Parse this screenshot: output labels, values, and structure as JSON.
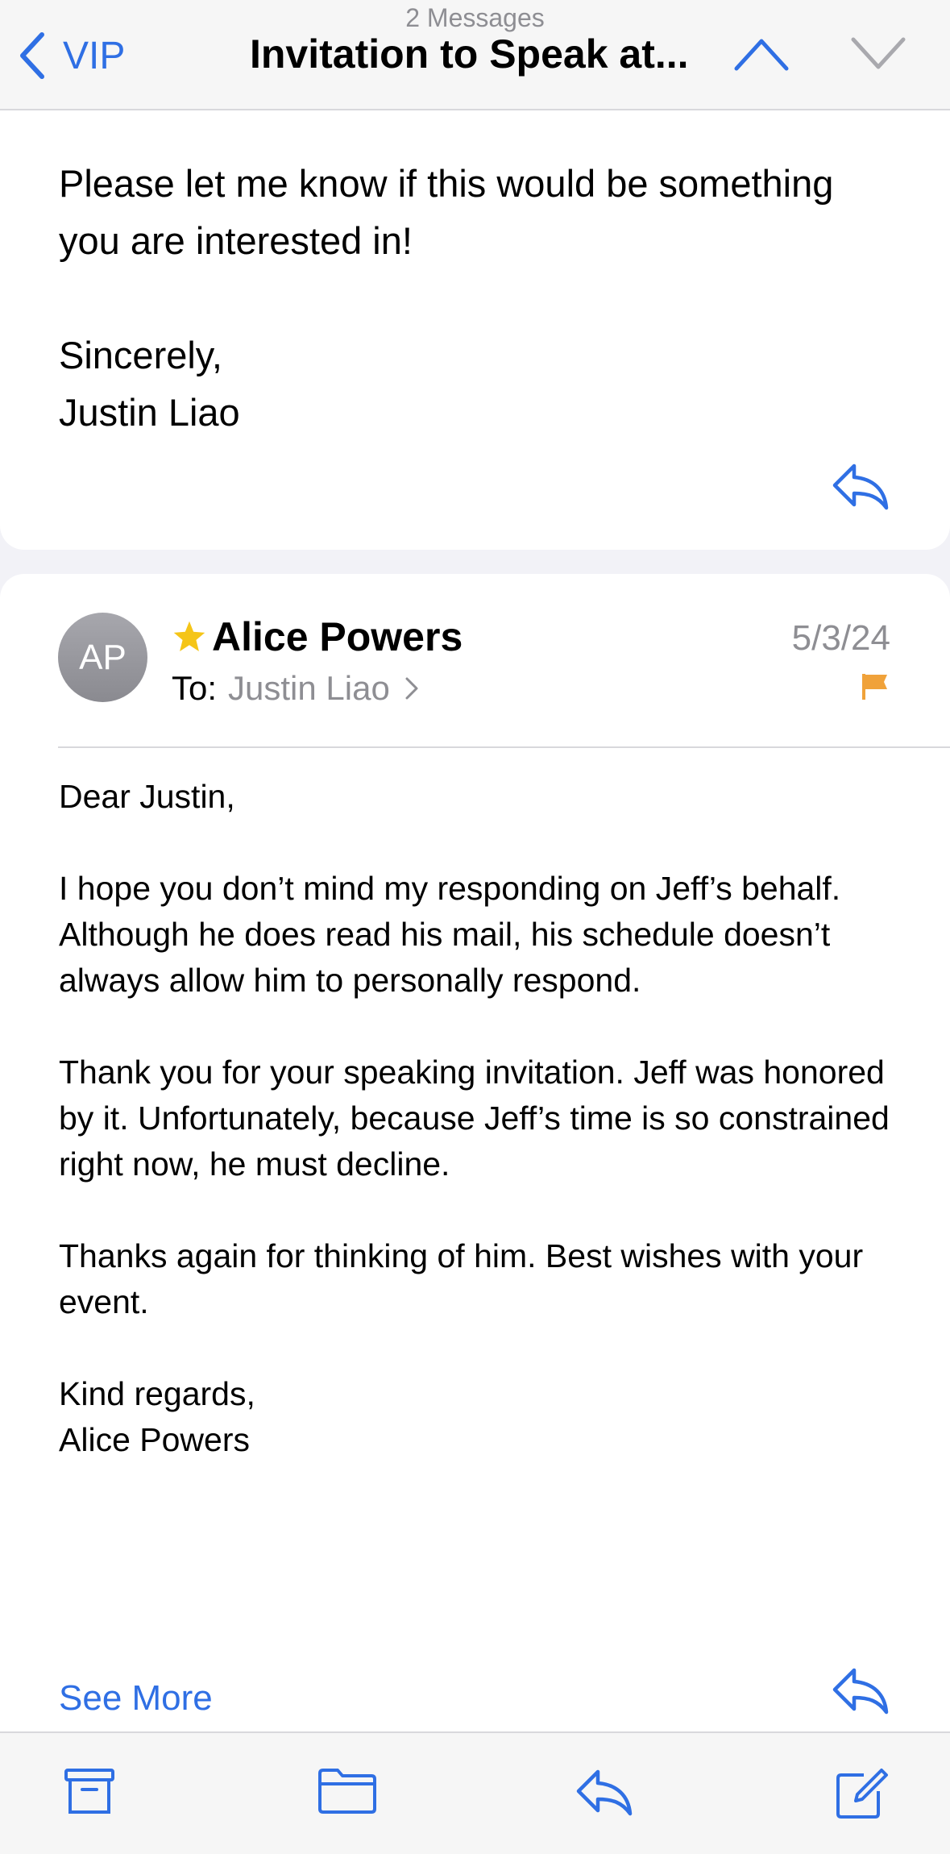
{
  "nav": {
    "message_count": "2 Messages",
    "back_label": "VIP",
    "title": "Invitation to Speak at..."
  },
  "message1": {
    "paragraphs": [
      "Please let me know if this would be something you are interested in!",
      "Sincerely,\nJustin Liao"
    ]
  },
  "message2": {
    "avatar_initials": "AP",
    "sender": "Alice Powers",
    "date": "5/3/24",
    "to_label": "To:",
    "to_name": "Justin Liao",
    "paragraphs": [
      "Dear Justin,",
      "I hope you don’t mind my responding on Jeff’s behalf. Although he does read his mail, his schedule doesn’t always allow him to personally respond.",
      "Thank you for your speaking invitation. Jeff was honored by it. Unfortunately, because Jeff’s time is so constrained right now, he must decline.",
      "Thanks again for thinking of him. Best wishes with your event.",
      "Kind regards,\nAlice Powers"
    ],
    "see_more": "See More"
  },
  "colors": {
    "accent": "#2f6fe4",
    "star": "#f5c518",
    "flag": "#f0a23a",
    "secondary_text": "#8e8e93"
  },
  "icons": {
    "back": "chevron-left-icon",
    "prev": "chevron-up-icon",
    "next": "chevron-down-icon",
    "reply": "reply-icon",
    "vip": "star-icon",
    "flag": "flag-icon",
    "toolbar": [
      "archive-icon",
      "folder-icon",
      "reply-icon",
      "compose-icon"
    ]
  }
}
